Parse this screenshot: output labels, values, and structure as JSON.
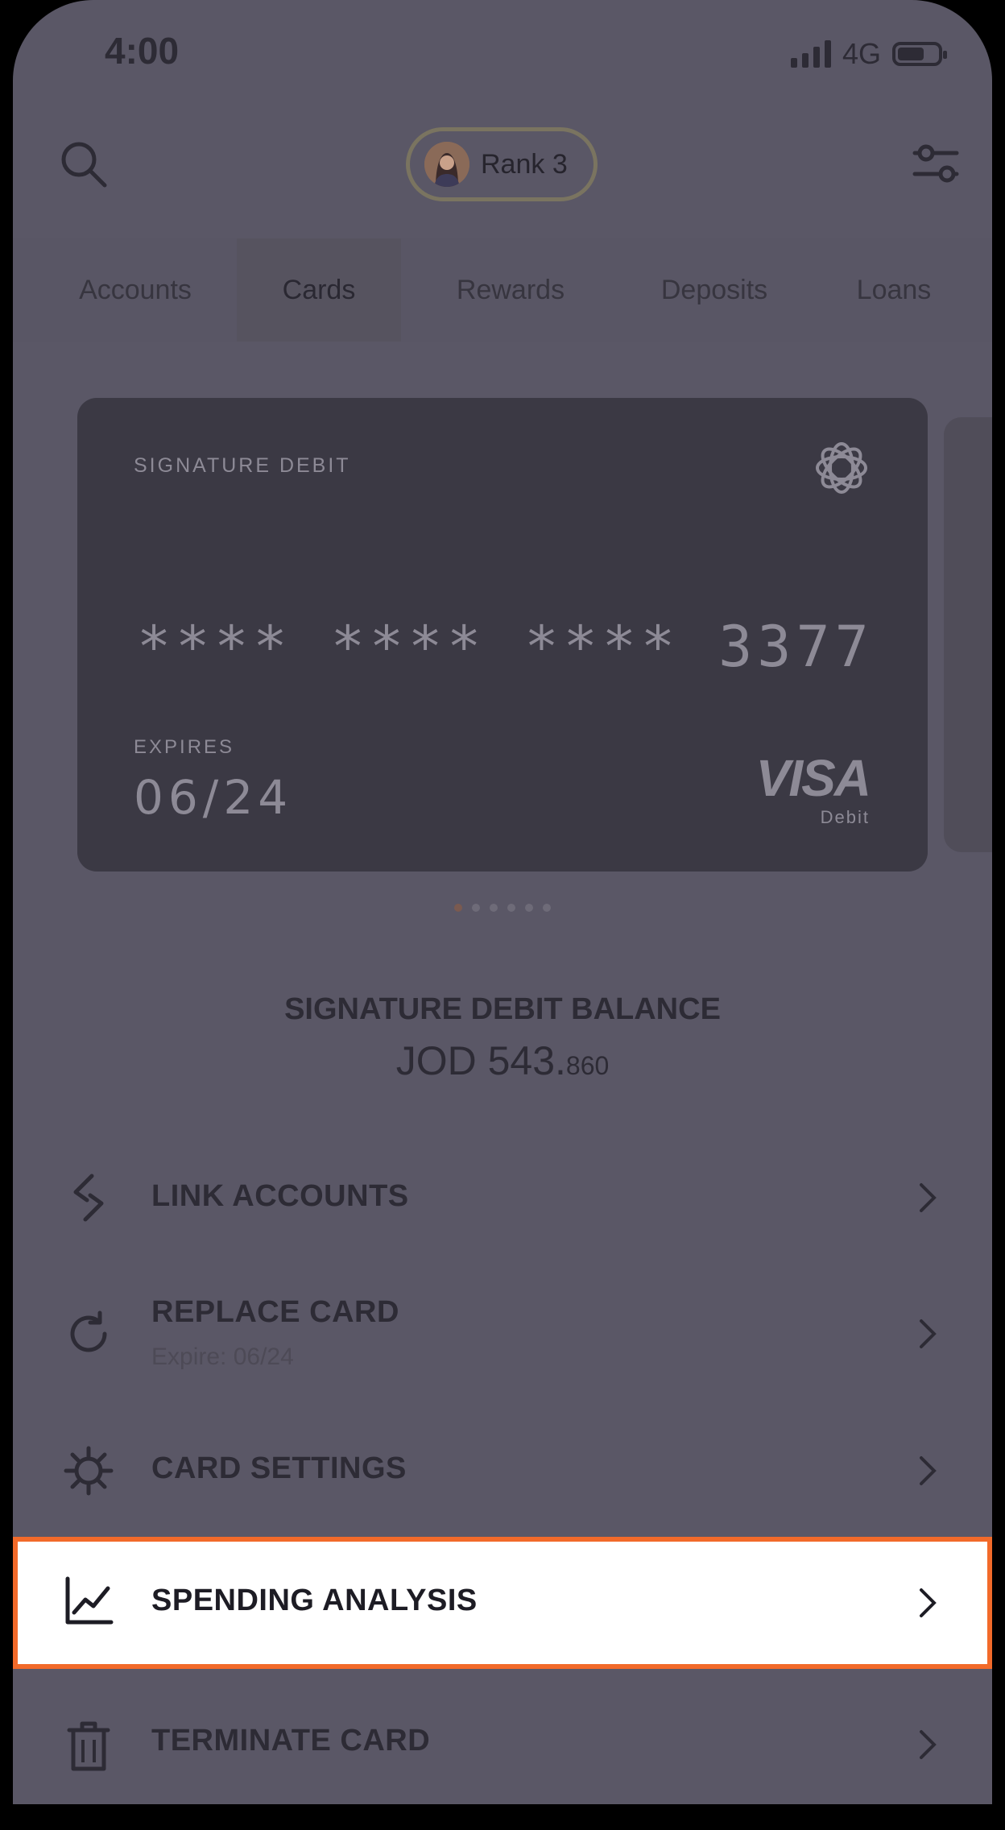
{
  "status_bar": {
    "time": "4:00",
    "network": "4G"
  },
  "header": {
    "rank_label": "Rank 3"
  },
  "tabs": [
    {
      "label": "Accounts"
    },
    {
      "label": "Cards"
    },
    {
      "label": "Rewards"
    },
    {
      "label": "Deposits"
    },
    {
      "label": "Loans"
    }
  ],
  "active_tab": "Cards",
  "card": {
    "type": "SIGNATURE DEBIT",
    "number_masked": "**** **** **** ",
    "number_last4": "3377",
    "expires_label": "EXPIRES",
    "expiry": "06/24",
    "brand": "VISA",
    "brand_sub": "Debit"
  },
  "pager": {
    "count": 6,
    "active_index": 0
  },
  "balance": {
    "title": "SIGNATURE DEBIT BALANCE",
    "amount_main": "JOD 543.",
    "amount_decimal": "860"
  },
  "menu": {
    "link_accounts": "LINK ACCOUNTS",
    "replace_card": "REPLACE CARD",
    "replace_card_sub": "Expire: 06/24",
    "card_settings": "CARD SETTINGS",
    "spending_analysis": "SPENDING ANALYSIS",
    "terminate_card": "TERMINATE CARD"
  },
  "colors": {
    "highlight_border": "#f26a2a",
    "overlay_bg": "#5a5766"
  }
}
